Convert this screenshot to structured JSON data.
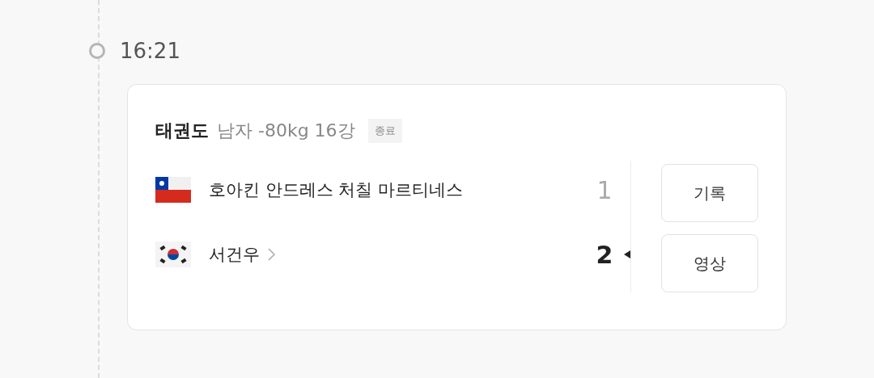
{
  "time": "16:21",
  "event": {
    "sport": "태권도",
    "detail": "남자 -80kg 16강",
    "status": "종료"
  },
  "players": [
    {
      "kind": "chile",
      "name": "호아킨 안드레스 처칠 마르티네스",
      "link": false,
      "score": "1",
      "winner": false
    },
    {
      "kind": "korea",
      "name": "서건우",
      "link": true,
      "score": "2",
      "winner": true
    }
  ],
  "buttons": [
    "기록",
    "영상"
  ]
}
